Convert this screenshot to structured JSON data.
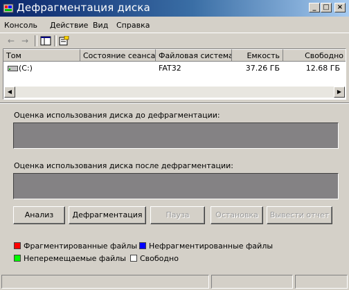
{
  "window": {
    "title": "Дефрагментация диска",
    "minimize_glyph": "_",
    "maximize_glyph": "□",
    "close_glyph": "×"
  },
  "menu": {
    "items": [
      "Консоль",
      "Действие",
      "Вид",
      "Справка"
    ]
  },
  "toolbar": {
    "icons": [
      "back-arrow-icon",
      "forward-arrow-icon",
      "show-hide-console-tree-icon",
      "properties-icon"
    ]
  },
  "volumes": {
    "columns": [
      "Том",
      "Состояние сеанса",
      "Файловая система",
      "Емкость",
      "Свободно"
    ],
    "rows": [
      {
        "volume": "(C:)",
        "session_status": "",
        "filesystem": "FAT32",
        "capacity": "37.26 ГБ",
        "free": "12.68 ГБ"
      }
    ]
  },
  "analysis": {
    "before_label": "Оценка использования диска до дефрагментации:",
    "after_label": "Оценка использования диска после дефрагментации:"
  },
  "buttons": {
    "analyze": "Анализ",
    "defragment": "Дефрагментация",
    "pause": "Пауза",
    "stop": "Остановка",
    "report": "Вывести отчет"
  },
  "legend": {
    "fragmented": "Фрагментированные файлы",
    "contiguous": "Нефрагментированные файлы",
    "unmovable": "Неперемещаемые файлы",
    "free": "Свободно",
    "colors": {
      "fragmented": "#ff0000",
      "contiguous": "#0000ff",
      "unmovable": "#00ff00",
      "free": "#ffffff"
    }
  }
}
